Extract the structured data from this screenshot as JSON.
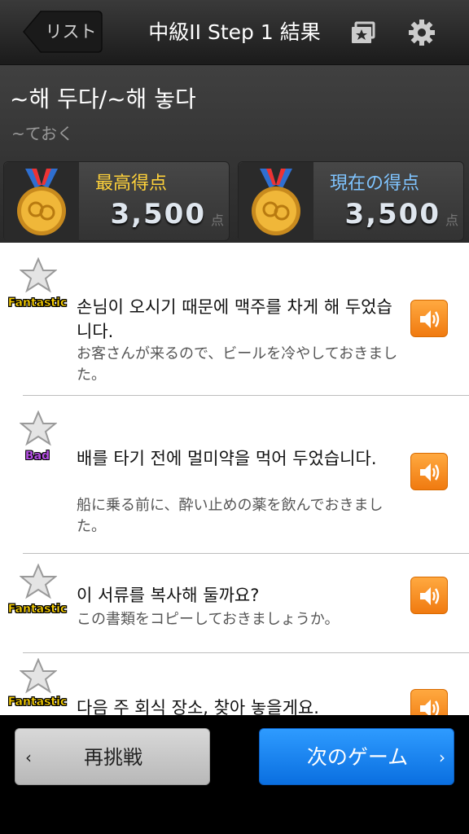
{
  "nav": {
    "back_label": "リスト",
    "title": "中級II Step 1 結果",
    "bookmark_icon": "bookmark-star-icon",
    "settings_icon": "gear-icon"
  },
  "header": {
    "grammar_title": "~해 두다/~해 놓다",
    "grammar_subtitle": "~ておく",
    "best_score": {
      "label": "最高得点",
      "value": "3,500",
      "unit": "点",
      "label_color": "#ffd23a"
    },
    "current_score": {
      "label": "現在の得点",
      "value": "3,500",
      "unit": "点",
      "label_color": "#7fc4ff"
    }
  },
  "items": [
    {
      "rating": "Fantastic",
      "korean": "손님이 오시기 때문에 맥주를 차게 해 두었습니다.",
      "japanese": "お客さんが来るので、ビールを冷やしておきました。"
    },
    {
      "rating": "Bad",
      "korean": "배를 타기 전에 멀미약을 먹어 두었습니다.",
      "japanese": "船に乗る前に、酔い止めの薬を飲んでおきました。"
    },
    {
      "rating": "Fantastic",
      "korean": "이 서류를 복사해 둘까요?",
      "japanese": "この書類をコピーしておきましょうか。"
    },
    {
      "rating": "Fantastic",
      "korean": "다음 주 회식 장소, 찾아 놓을게요.",
      "japanese": ""
    }
  ],
  "footer": {
    "retry_label": "再挑戦",
    "next_label": "次のゲーム"
  },
  "colors": {
    "accent_orange": "#f58a1f",
    "accent_blue": "#1a82f0",
    "fantastic": "#ffd400",
    "bad": "#b24fe0"
  }
}
